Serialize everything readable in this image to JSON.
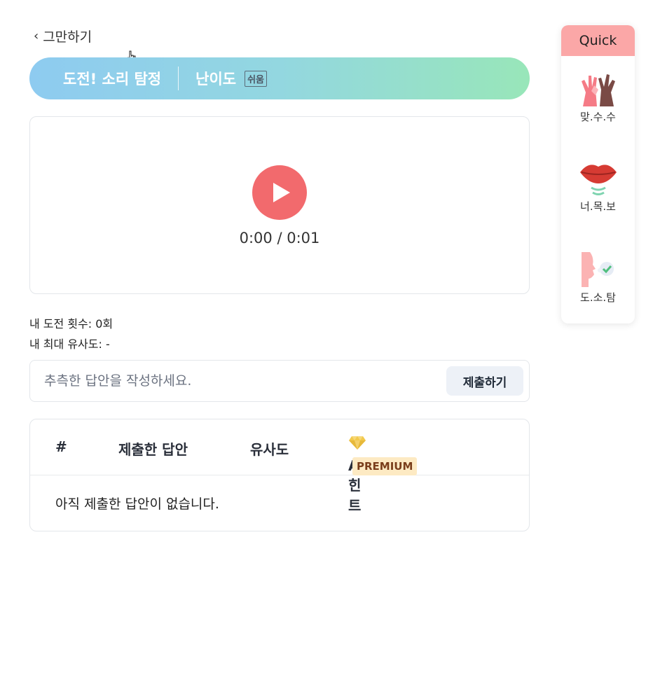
{
  "nav": {
    "back_label": "그만하기"
  },
  "banner": {
    "title": "도전! 소리 탐정",
    "difficulty_label": "난이도",
    "difficulty_value": "쉬움"
  },
  "player": {
    "time": "0:00 / 0:01"
  },
  "stats": {
    "attempts": "내 도전 횟수: 0회",
    "best_similarity": "내 최대 유사도: -"
  },
  "answer": {
    "placeholder": "추측한 답안을 작성하세요.",
    "submit_label": "제출하기"
  },
  "history": {
    "columns": [
      "#",
      "제출한 답안",
      "유사도",
      "AI 힌트"
    ],
    "premium_badge": "PREMIUM",
    "empty_message": "아직 제출한 답안이 없습니다."
  },
  "quick": {
    "title": "Quick",
    "items": [
      {
        "label": "맞.수.수",
        "icon": "hands-icon"
      },
      {
        "label": "너.목.보",
        "icon": "lips-icon"
      },
      {
        "label": "도.소.탐",
        "icon": "face-check-icon"
      }
    ]
  },
  "colors": {
    "accent_red": "#f26a6d",
    "quick_header": "#fba7a7",
    "premium_bg": "#fdeac3"
  }
}
